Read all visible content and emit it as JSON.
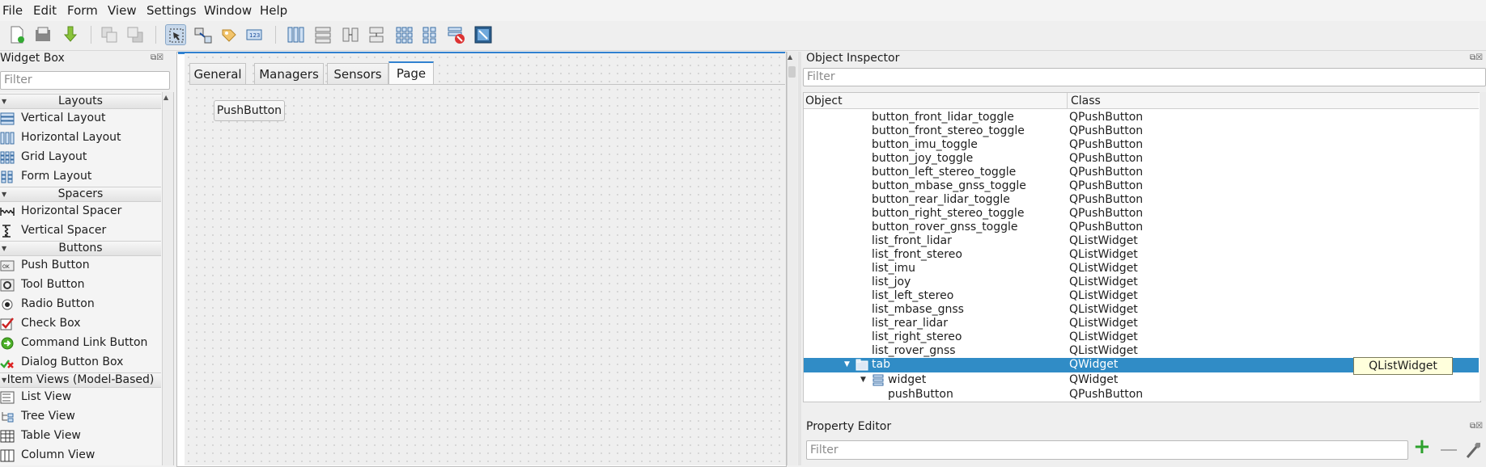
{
  "menu": [
    "File",
    "Edit",
    "Form",
    "View",
    "Settings",
    "Window",
    "Help"
  ],
  "widget_box": {
    "title": "Widget Box",
    "filter_placeholder": "Filter",
    "categories": {
      "layouts": "Layouts",
      "spacers": "Spacers",
      "buttons": "Buttons",
      "item_views": "Item Views (Model-Based)"
    },
    "items": {
      "vertical_layout": "Vertical Layout",
      "horizontal_layout": "Horizontal Layout",
      "grid_layout": "Grid Layout",
      "form_layout": "Form Layout",
      "horizontal_spacer": "Horizontal Spacer",
      "vertical_spacer": "Vertical Spacer",
      "push_button": "Push Button",
      "tool_button": "Tool Button",
      "radio_button": "Radio Button",
      "check_box": "Check Box",
      "command_link_button": "Command Link Button",
      "dialog_button_box": "Dialog Button Box",
      "list_view": "List View",
      "tree_view": "Tree View",
      "table_view": "Table View",
      "column_view": "Column View"
    }
  },
  "form": {
    "tabs": [
      "General",
      "Managers",
      "Sensors",
      "Page"
    ],
    "active_tab": "Page",
    "push_button_label": "PushButton"
  },
  "object_inspector": {
    "title": "Object Inspector",
    "filter_placeholder": "Filter",
    "col_object": "Object",
    "col_class": "Class",
    "rows": [
      {
        "name": "button_front_lidar_toggle",
        "cls": "QPushButton"
      },
      {
        "name": "button_front_stereo_toggle",
        "cls": "QPushButton"
      },
      {
        "name": "button_imu_toggle",
        "cls": "QPushButton"
      },
      {
        "name": "button_joy_toggle",
        "cls": "QPushButton"
      },
      {
        "name": "button_left_stereo_toggle",
        "cls": "QPushButton"
      },
      {
        "name": "button_mbase_gnss_toggle",
        "cls": "QPushButton"
      },
      {
        "name": "button_rear_lidar_toggle",
        "cls": "QPushButton"
      },
      {
        "name": "button_right_stereo_toggle",
        "cls": "QPushButton"
      },
      {
        "name": "button_rover_gnss_toggle",
        "cls": "QPushButton"
      },
      {
        "name": "list_front_lidar",
        "cls": "QListWidget"
      },
      {
        "name": "list_front_stereo",
        "cls": "QListWidget"
      },
      {
        "name": "list_imu",
        "cls": "QListWidget"
      },
      {
        "name": "list_joy",
        "cls": "QListWidget"
      },
      {
        "name": "list_left_stereo",
        "cls": "QListWidget"
      },
      {
        "name": "list_mbase_gnss",
        "cls": "QListWidget"
      },
      {
        "name": "list_rear_lidar",
        "cls": "QListWidget"
      },
      {
        "name": "list_right_stereo",
        "cls": "QListWidget"
      },
      {
        "name": "list_rover_gnss",
        "cls": "QListWidget"
      }
    ],
    "tab_row": {
      "name": "tab",
      "cls": "QWidget"
    },
    "widget_row": {
      "name": "widget",
      "cls": "QWidget"
    },
    "pushbutton_row": {
      "name": "pushButton",
      "cls": "QPushButton"
    },
    "tooltip": "QListWidget"
  },
  "property_editor": {
    "title": "Property Editor",
    "filter_placeholder": "Filter"
  },
  "colors": {
    "selection": "#308cc6",
    "tab_accent": "#3081d0",
    "tooltip_bg": "#ffffdc"
  }
}
